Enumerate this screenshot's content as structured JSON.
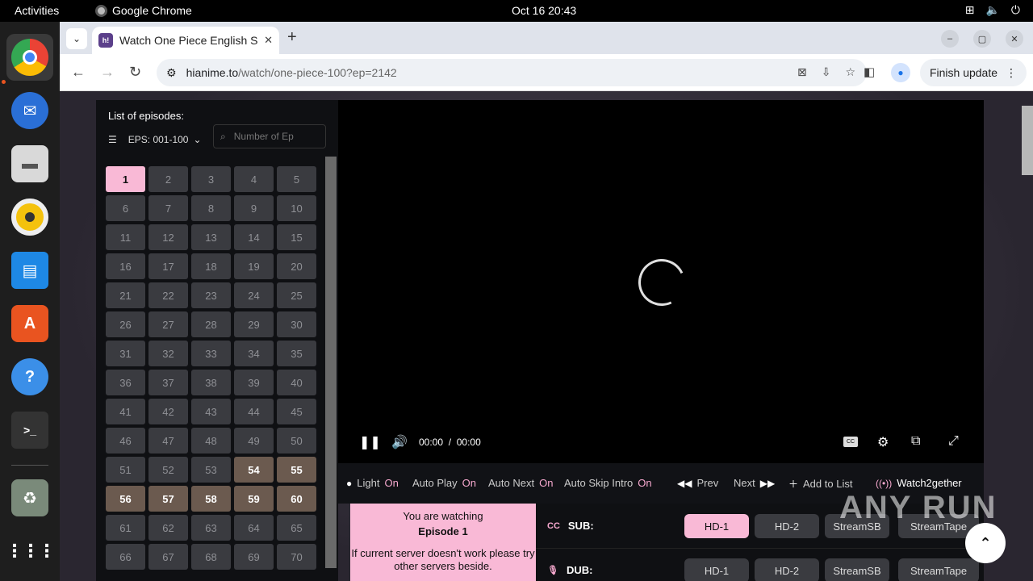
{
  "topbar": {
    "activities": "Activities",
    "app_name": "Google Chrome",
    "clock": "Oct 16  20:43"
  },
  "dock": {
    "items": [
      "chrome-icon",
      "thunderbird-icon",
      "files-icon",
      "rhythmbox-icon",
      "writer-icon",
      "app-center-icon",
      "help-icon",
      "terminal-icon",
      "trash-icon",
      "apps-grid-icon"
    ]
  },
  "browser": {
    "tab_title": "Watch One Piece English Sub",
    "url_host": "hianime.to",
    "url_path": "/watch/one-piece-100?ep=2142",
    "finish_update": "Finish update"
  },
  "episodes": {
    "title": "List of episodes:",
    "range": "EPS: 001-100",
    "search_placeholder": "Number of Ep",
    "active": 1,
    "filler_from": 54,
    "filler_to": 60,
    "count": 70
  },
  "player": {
    "current_time": "00:00",
    "separator": "/",
    "duration": "00:00",
    "cc_label": "CC"
  },
  "options": {
    "light_label": "Light",
    "light_value": "On",
    "autoplay_label": "Auto Play",
    "autoplay_value": "On",
    "autonext_label": "Auto Next",
    "autonext_value": "On",
    "autoskip_label": "Auto Skip Intro",
    "autoskip_value": "On",
    "prev": "Prev",
    "next": "Next",
    "add_to_list": "Add to List",
    "watch2gether": "Watch2gether"
  },
  "watching": {
    "line1": "You are watching",
    "line2": "Episode 1",
    "line3": "If current server doesn't work please try other servers beside."
  },
  "servers": {
    "sub_label": "SUB:",
    "dub_label": "DUB:",
    "sub": [
      "HD-1",
      "HD-2",
      "StreamSB",
      "StreamTape"
    ],
    "dub": [
      "HD-1",
      "HD-2",
      "StreamSB",
      "StreamTape"
    ]
  },
  "watermark": "ANY RUN",
  "colors": {
    "accent_pink": "#f9b9d6",
    "filler_brown": "#6b5a4f",
    "panel_dark": "#0f1013"
  }
}
